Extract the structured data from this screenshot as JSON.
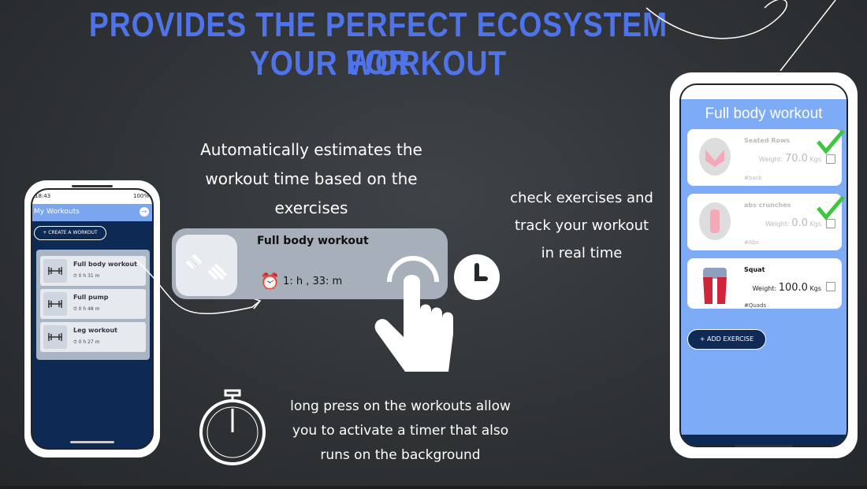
{
  "headline": {
    "line1": "PROVIDES THE PERFECT ECOSYSTEM FOR",
    "line2": "YOUR WORKOUT"
  },
  "captions": {
    "estimate": "Automatically estimates the workout time based on the exercises",
    "estimate_lines": [
      "Automatically estimates the",
      "workout time based on the",
      "exercises"
    ],
    "check_lines": [
      "check exercises and",
      "track your workout",
      "in real time"
    ],
    "longpress_lines": [
      "long press on the workouts allow",
      "you to activate a timer that also",
      "runs on the background"
    ]
  },
  "left_phone": {
    "status_time": "18:43",
    "status_right": "100%",
    "app_title": "My Workouts",
    "create_button": "+ CREATE A WORKOUT",
    "workouts": [
      {
        "name": "Full body workout",
        "hours": "0",
        "minutes": "31"
      },
      {
        "name": "Full pump",
        "hours": "0",
        "minutes": "48"
      },
      {
        "name": "Leg workout",
        "hours": "0",
        "minutes": "27"
      }
    ],
    "h_label": "h",
    "m_label": "m"
  },
  "workout_card": {
    "title": "Full body workout",
    "hours": "1",
    "minutes": "33",
    "time_text": "1: h , 33: m",
    "icon": "dumbbells-icon"
  },
  "right_phone": {
    "title": "Full body workout",
    "exercises": [
      {
        "name": "Seated Rows",
        "weight_label": "Weight:",
        "weight": "70.0",
        "unit": "Kgs",
        "tag": "#back",
        "checked": true
      },
      {
        "name": "abs crunches",
        "weight_label": "Weight:",
        "weight": "0.0",
        "unit": "Kgs",
        "tag": "#Abs",
        "checked": true
      },
      {
        "name": "Squat",
        "weight_label": "Weight:",
        "weight": "100.0",
        "unit": "Kgs",
        "tag": "#Quads",
        "checked": false
      }
    ],
    "add_button": "+ ADD EXERCISE"
  },
  "colors": {
    "headline": "#4f73e8",
    "app_dark": "#0d2a55",
    "app_light": "#7eabf5",
    "check_green": "#3ec63e"
  }
}
